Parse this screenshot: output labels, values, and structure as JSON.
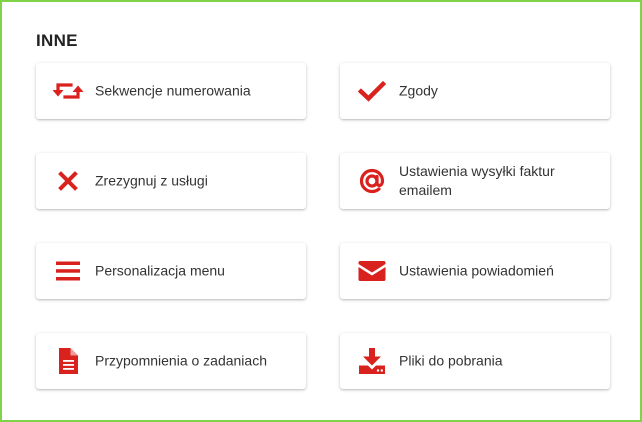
{
  "section": {
    "title": "INNE"
  },
  "accent_color": "#d9211d",
  "tiles": [
    {
      "label": "Sekwencje numerowania",
      "icon": "retweet-icon"
    },
    {
      "label": "Zgody",
      "icon": "check-icon"
    },
    {
      "label": "Zrezygnuj z usługi",
      "icon": "close-icon"
    },
    {
      "label": "Ustawienia wysyłki faktur emailem",
      "icon": "at-icon"
    },
    {
      "label": "Personalizacja menu",
      "icon": "menu-icon"
    },
    {
      "label": "Ustawienia powiadomień",
      "icon": "envelope-icon"
    },
    {
      "label": "Przypomnienia o zadaniach",
      "icon": "document-icon"
    },
    {
      "label": "Pliki do pobrania",
      "icon": "download-icon"
    }
  ]
}
